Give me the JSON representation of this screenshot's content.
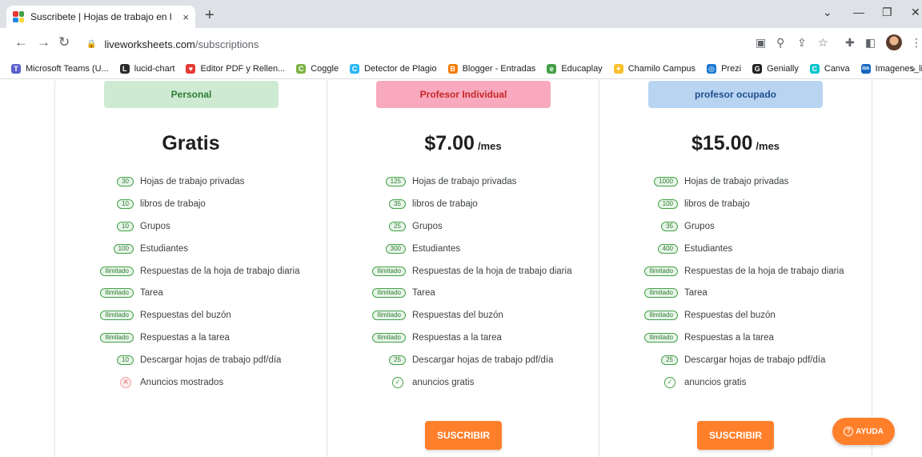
{
  "browser": {
    "tab_title": "Suscribete | Hojas de trabajo en l",
    "new_tab": "+",
    "close_tab": "×",
    "url_host": "liveworksheets.com",
    "url_path": "/subscriptions",
    "bookmarks": [
      {
        "label": "Microsoft Teams (U...",
        "icon": "teams-icon",
        "color": "#5b5fc7",
        "glyph": "T"
      },
      {
        "label": "lucid-chart",
        "icon": "lucid-icon",
        "color": "#2b2b2b",
        "glyph": "L"
      },
      {
        "label": "Editor PDF y Rellen...",
        "icon": "pdf-heart-icon",
        "color": "#e53935",
        "glyph": "♥"
      },
      {
        "label": "Coggle",
        "icon": "coggle-icon",
        "color": "#7cb342",
        "glyph": "C"
      },
      {
        "label": "Detector de Plagio",
        "icon": "plagio-icon",
        "color": "#29b6f6",
        "glyph": "C"
      },
      {
        "label": "Blogger - Entradas",
        "icon": "blogger-icon",
        "color": "#f57c00",
        "glyph": "B"
      },
      {
        "label": "Educaplay",
        "icon": "educaplay-icon",
        "color": "#43a047",
        "glyph": "e"
      },
      {
        "label": "Chamilo Campus",
        "icon": "chamilo-icon",
        "color": "#fbc02d",
        "glyph": "✦"
      },
      {
        "label": "Prezi",
        "icon": "prezi-icon",
        "color": "#1976d2",
        "glyph": "◎"
      },
      {
        "label": "Genially",
        "icon": "genially-icon",
        "color": "#212121",
        "glyph": "G"
      },
      {
        "label": "Canva",
        "icon": "canva-icon",
        "color": "#00c4cc",
        "glyph": "C"
      },
      {
        "label": "Imagenes_link",
        "icon": "imagenes-icon",
        "color": "#1565c0",
        "glyph": "ibb"
      }
    ],
    "bookmarks_more": "»"
  },
  "plans": [
    {
      "name": "Personal",
      "head_bg": "#cfead3",
      "head_color": "#2e7d32",
      "price": "Gratis",
      "per": "",
      "features": [
        {
          "badge": "30",
          "label": "Hojas de trabajo privadas"
        },
        {
          "badge": "10",
          "label": "libros de trabajo"
        },
        {
          "badge": "10",
          "label": "Grupos"
        },
        {
          "badge": "100",
          "label": "Estudiantes"
        },
        {
          "badge": "Ilimitado",
          "label": "Respuestas de la hoja de trabajo diaria"
        },
        {
          "badge": "Ilimitado",
          "label": "Tarea"
        },
        {
          "badge": "Ilimitado",
          "label": "Respuestas del buzón"
        },
        {
          "badge": "Ilimitado",
          "label": "Respuestas a la tarea"
        },
        {
          "badge": "10",
          "label": "Descargar hojas de trabajo pdf/día"
        },
        {
          "mark": "no",
          "label": "Anuncios mostrados"
        }
      ],
      "button": ""
    },
    {
      "name": "Profesor Individual",
      "head_bg": "#f8a9bd",
      "head_color": "#c62828",
      "price": "$7.00",
      "per": "/mes",
      "features": [
        {
          "badge": "125",
          "label": "Hojas de trabajo privadas"
        },
        {
          "badge": "35",
          "label": "libros de trabajo"
        },
        {
          "badge": "25",
          "label": "Grupos"
        },
        {
          "badge": "300",
          "label": "Estudiantes"
        },
        {
          "badge": "Ilimitado",
          "label": "Respuestas de la hoja de trabajo diaria"
        },
        {
          "badge": "Ilimitado",
          "label": "Tarea"
        },
        {
          "badge": "Ilimitado",
          "label": "Respuestas del buzón"
        },
        {
          "badge": "Ilimitado",
          "label": "Respuestas a la tarea"
        },
        {
          "badge": "25",
          "label": "Descargar hojas de trabajo pdf/día"
        },
        {
          "mark": "yes",
          "label": "anuncios gratis"
        }
      ],
      "button": "SUSCRIBIR"
    },
    {
      "name": "profesor ocupado",
      "head_bg": "#b9d4f1",
      "head_color": "#1f4f8f",
      "price": "$15.00",
      "per": "/mes",
      "features": [
        {
          "badge": "1000",
          "label": "Hojas de trabajo privadas"
        },
        {
          "badge": "100",
          "label": "libros de trabajo"
        },
        {
          "badge": "35",
          "label": "Grupos"
        },
        {
          "badge": "400",
          "label": "Estudiantes"
        },
        {
          "badge": "Ilimitado",
          "label": "Respuestas de la hoja de trabajo diaria"
        },
        {
          "badge": "Ilimitado",
          "label": "Tarea"
        },
        {
          "badge": "Ilimitado",
          "label": "Respuestas del buzón"
        },
        {
          "badge": "Ilimitado",
          "label": "Respuestas a la tarea"
        },
        {
          "badge": "25",
          "label": "Descargar hojas de trabajo pdf/día"
        },
        {
          "mark": "yes",
          "label": "anuncios gratis"
        }
      ],
      "button": "SUSCRIBIR"
    }
  ],
  "help_button": "AYUDA",
  "colors": {
    "accent": "#ff7f2a",
    "badge_green": "#43a047"
  }
}
